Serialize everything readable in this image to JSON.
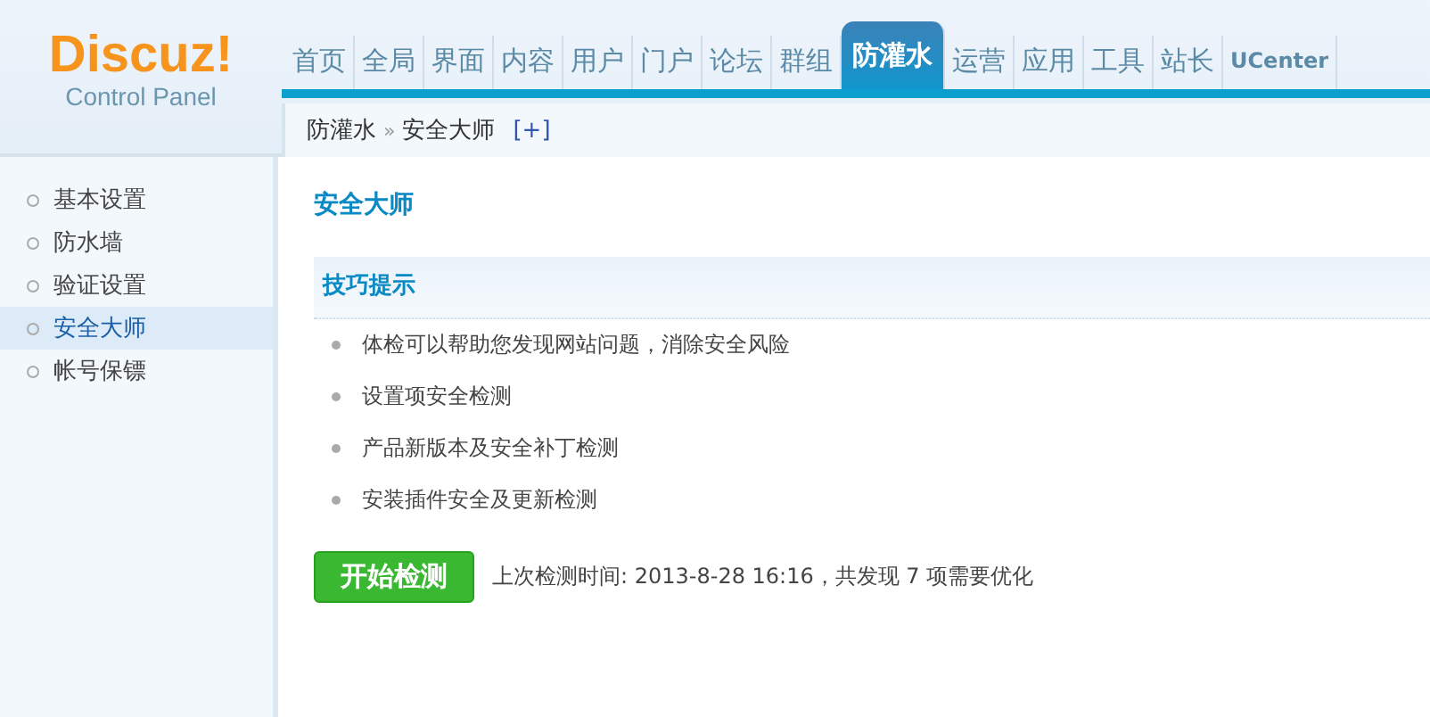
{
  "logo": {
    "title": "Discuz!",
    "subtitle": "Control Panel"
  },
  "nav": [
    {
      "label": "首页",
      "selected": false
    },
    {
      "label": "全局",
      "selected": false
    },
    {
      "label": "界面",
      "selected": false
    },
    {
      "label": "内容",
      "selected": false
    },
    {
      "label": "用户",
      "selected": false
    },
    {
      "label": "门户",
      "selected": false
    },
    {
      "label": "论坛",
      "selected": false
    },
    {
      "label": "群组",
      "selected": false
    },
    {
      "label": "防灌水",
      "selected": true
    },
    {
      "label": "运营",
      "selected": false
    },
    {
      "label": "应用",
      "selected": false
    },
    {
      "label": "工具",
      "selected": false
    },
    {
      "label": "站长",
      "selected": false
    },
    {
      "label": "UCenter",
      "selected": false
    }
  ],
  "breadcrumb": {
    "parent": "防灌水",
    "separator": "»",
    "current": "安全大师",
    "add": "[+]"
  },
  "sidebar": {
    "items": [
      {
        "label": "基本设置",
        "selected": false
      },
      {
        "label": "防水墙",
        "selected": false
      },
      {
        "label": "验证设置",
        "selected": false
      },
      {
        "label": "安全大师",
        "selected": true
      },
      {
        "label": "帐号保镖",
        "selected": false
      }
    ]
  },
  "content": {
    "title": "安全大师",
    "tips_title": "技巧提示",
    "tips": [
      "体检可以帮助您发现网站问题，消除安全风险",
      "设置项安全检测",
      "产品新版本及安全补丁检测",
      "安装插件安全及更新检测"
    ],
    "button": "开始检测",
    "last_check": "上次检测时间: 2013-8-28 16:16，共发现 7 项需要优化"
  }
}
